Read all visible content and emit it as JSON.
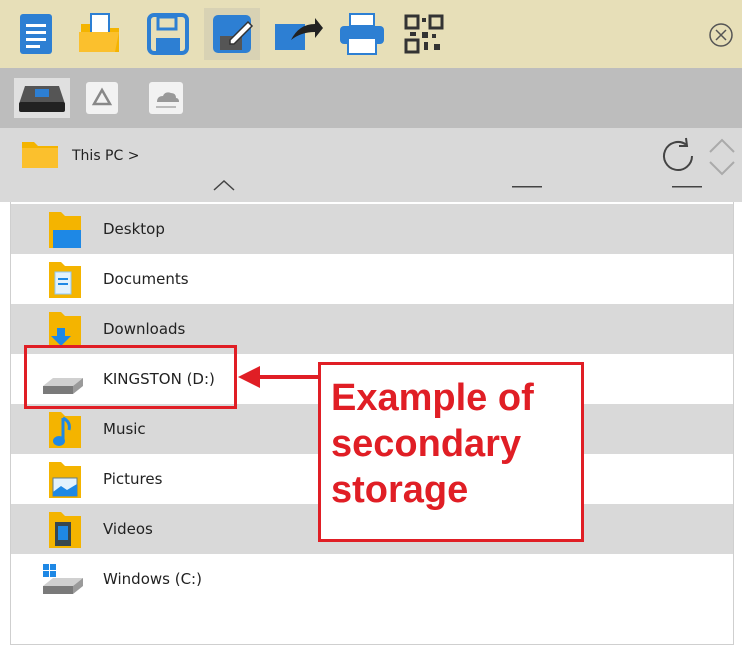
{
  "toolbar": {
    "buttons": [
      "new-document",
      "open-folder",
      "save",
      "save-as",
      "share",
      "print",
      "qr-code"
    ],
    "close_icon": "close-circle-icon"
  },
  "services": [
    "local-drive",
    "google-drive",
    "onedrive"
  ],
  "path": {
    "label": "This PC >"
  },
  "list": {
    "items": [
      {
        "label": "Desktop",
        "icon": "folder-desktop-icon"
      },
      {
        "label": "Documents",
        "icon": "folder-documents-icon"
      },
      {
        "label": "Downloads",
        "icon": "folder-downloads-icon"
      },
      {
        "label": "KINGSTON (D:)",
        "icon": "drive-icon"
      },
      {
        "label": "Music",
        "icon": "folder-music-icon"
      },
      {
        "label": "Pictures",
        "icon": "folder-pictures-icon"
      },
      {
        "label": "Videos",
        "icon": "folder-videos-icon"
      },
      {
        "label": "Windows (C:)",
        "icon": "windows-drive-icon"
      }
    ]
  },
  "callout": {
    "text": "Example of\nsecondary\nstorage",
    "color": "#e01e25"
  }
}
